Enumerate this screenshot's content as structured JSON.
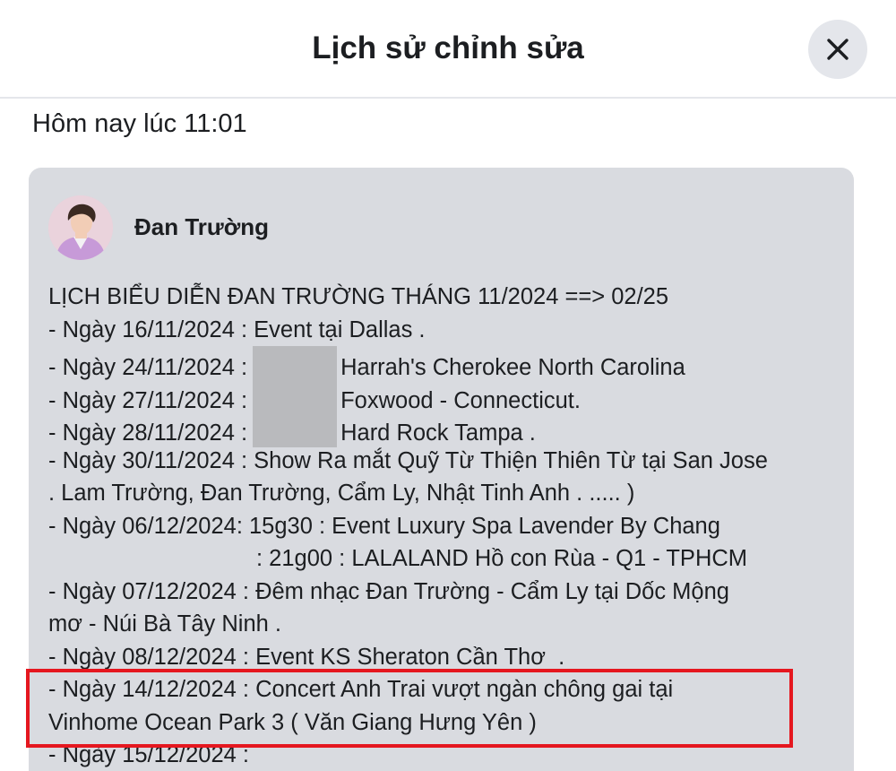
{
  "header": {
    "title": "Lịch sử chỉnh sửa",
    "close_icon": "close-icon"
  },
  "timestamp": "Hôm nay lúc 11:01",
  "post": {
    "author": "Đan Trường",
    "avatar_icon": "avatar",
    "lines": {
      "l0": "LỊCH BIỂU DIỄN ĐAN TRƯỜNG THÁNG 11/2024 ==> 02/25",
      "l1": "- Ngày 16/11/2024 : Event tại Dallas .",
      "l2a": "- Ngày 24/11/2024 :",
      "l2b": "Harrah's Cherokee North Carolina",
      "l3a": "- Ngày 27/11/2024 :",
      "l3b": "Foxwood - Connecticut.",
      "l4a": "- Ngày 28/11/2024 :",
      "l4b": "Hard Rock Tampa .",
      "l5": "- Ngày 30/11/2024 : Show Ra mắt Quỹ Từ Thiện Thiên Từ tại San Jose",
      "l6": ". Lam Trường, Đan Trường, Cẩm Ly, Nhật Tinh Anh . ..... )",
      "l7": "- Ngày 06/12/2024: 15g30 : Event Luxury Spa Lavender By Chang",
      "l8": ": 21g00 : LALALAND Hồ con Rùa - Q1 - TPHCM",
      "l9": "- Ngày 07/12/2024 : Đêm nhạc Đan Trường - Cẩm Ly tại Dốc Mộng",
      "l10": "mơ - Núi Bà Tây Ninh .",
      "l11": "- Ngày 08/12/2024 : Event KS Sheraton Cần Thơ  .",
      "l12": "- Ngày 14/12/2024 : Concert Anh Trai vượt ngàn chông gai tại",
      "l13": "Vinhome Ocean Park 3 ( Văn Giang Hưng Yên )",
      "l14": "- Ngày 15/12/2024 :"
    }
  },
  "colors": {
    "highlight": "#e5171f",
    "card_bg": "#d9dbe0",
    "close_bg": "#e4e6eb"
  }
}
